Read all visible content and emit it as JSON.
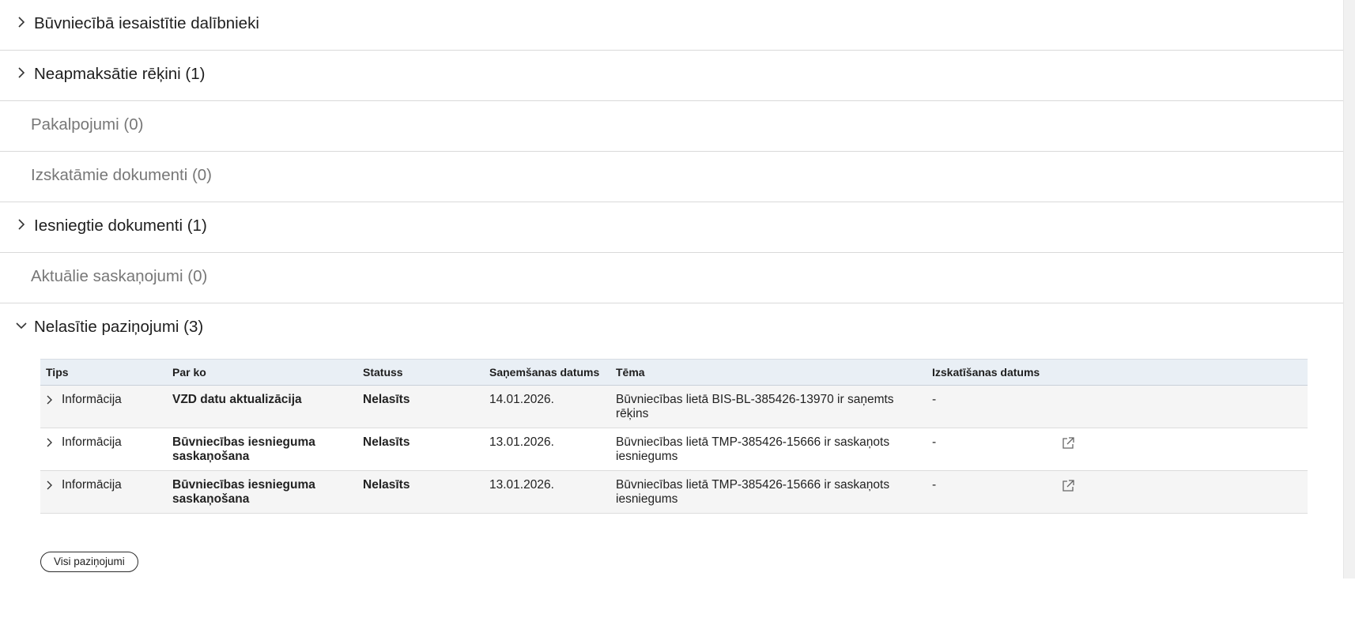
{
  "sections": [
    {
      "label": "Būvniecībā iesaistītie dalībnieki"
    },
    {
      "label": "Neapmaksātie rēķini (1)"
    },
    {
      "label": "Pakalpojumi (0)"
    },
    {
      "label": "Izskatāmie dokumenti (0)"
    },
    {
      "label": "Iesniegtie dokumenti (1)"
    },
    {
      "label": "Aktuālie saskaņojumi (0)"
    },
    {
      "label": "Nelasītie paziņojumi (3)"
    }
  ],
  "notifications": {
    "columns": [
      "Tips",
      "Par ko",
      "Statuss",
      "Saņemšanas datums",
      "Tēma",
      "Izskatīšanas datums"
    ],
    "rows": [
      {
        "tips": "Informācija",
        "par_ko": "VZD datu aktualizācija",
        "statuss": "Nelasīts",
        "datums": "14.01.2026.",
        "tema": "Būvniecības lietā BIS-BL-385426-13970 ir saņemts rēķins",
        "izskatisanas": "-"
      },
      {
        "tips": "Informācija",
        "par_ko": "Būvniecības iesnieguma saskaņošana",
        "statuss": "Nelasīts",
        "datums": "13.01.2026.",
        "tema": "Būvniecības lietā TMP-385426-15666 ir saskaņots iesniegums",
        "izskatisanas": "-"
      },
      {
        "tips": "Informācija",
        "par_ko": "Būvniecības iesnieguma saskaņošana",
        "statuss": "Nelasīts",
        "datums": "13.01.2026.",
        "tema": "Būvniecības lietā TMP-385426-15666 ir saskaņots iesniegums",
        "izskatisanas": "-"
      }
    ],
    "all_button": "Visi paziņojumi"
  },
  "icons": {
    "collapsed": "chevron-right-icon",
    "expanded": "chevron-down-icon",
    "row_expand": "chevron-right-icon",
    "open_external": "external-link-icon"
  },
  "colors": {
    "header_bg": "#e9eff5",
    "row_alt_bg": "#f5f5f5",
    "disabled_text": "#777777"
  }
}
